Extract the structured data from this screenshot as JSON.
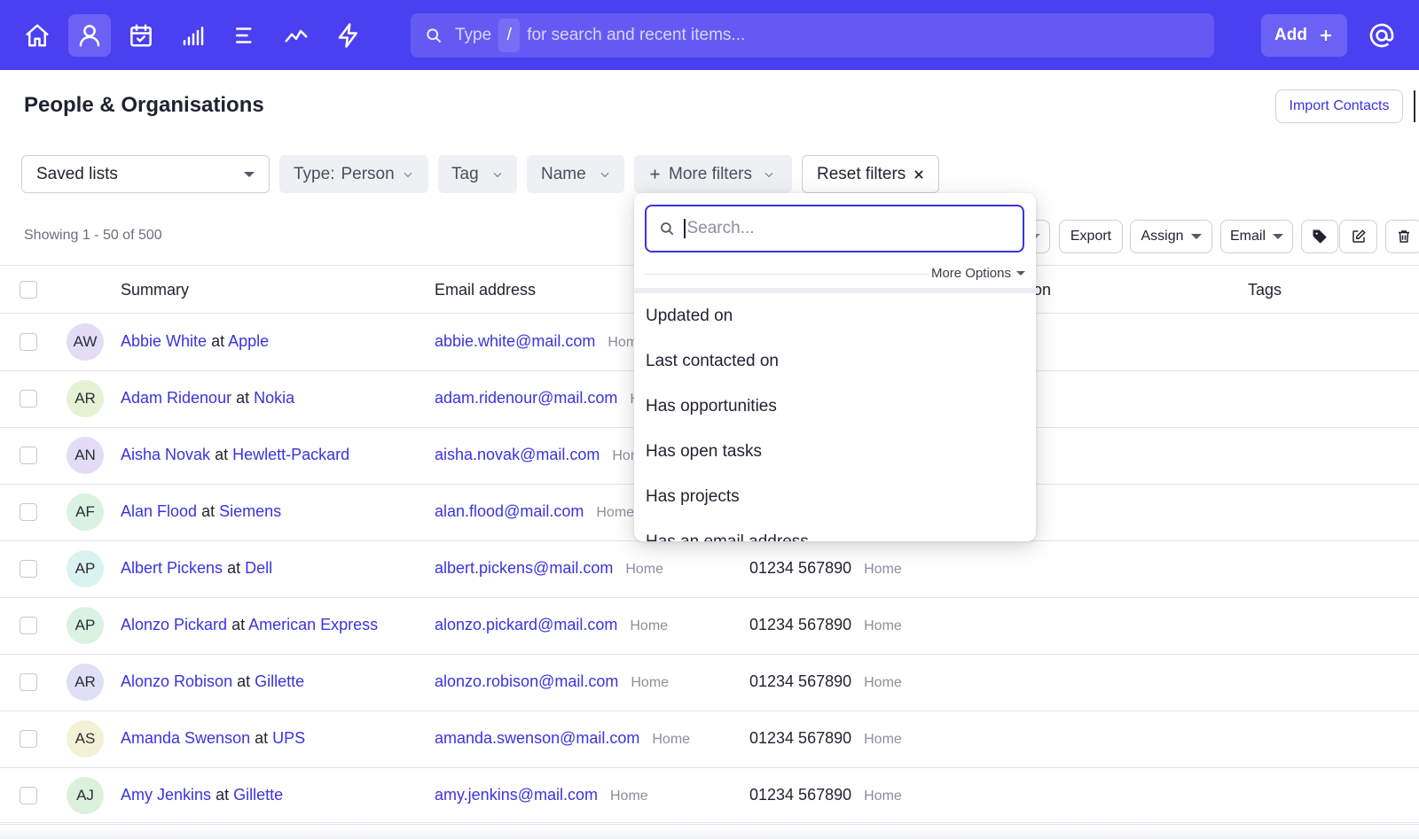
{
  "topbar": {
    "search_prefix": "Type",
    "search_key": "/",
    "search_suffix": "for search and recent items...",
    "add_label": "Add",
    "nav_icons": [
      "home-icon",
      "person-icon",
      "calendar-check-icon",
      "bar-signal-icon",
      "list-icon",
      "trend-line-icon",
      "lightning-icon"
    ],
    "accent": "#4b3ff2"
  },
  "page": {
    "title": "People & Organisations",
    "import_label": "Import Contacts",
    "showing": "Showing 1 - 50 of 500"
  },
  "filters": {
    "saved_lists": "Saved lists",
    "type_label": "Type:",
    "type_value": "Person",
    "tag": "Tag",
    "name": "Name",
    "more_filters": "More filters",
    "reset": "Reset filters"
  },
  "actions": {
    "export": "Export",
    "assign": "Assign",
    "email": "Email"
  },
  "table": {
    "headers": {
      "summary": "Summary",
      "email": "Email address",
      "hidden_col_tail": "on",
      "tags": "Tags"
    },
    "at": "at",
    "rows": [
      {
        "initials": "AW",
        "name": "Abbie White",
        "org": "Apple",
        "email": "abbie.white@mail.com",
        "email_label": "Home",
        "phone": "",
        "phone_label": "",
        "avatar": "#e3dcf6"
      },
      {
        "initials": "AR",
        "name": "Adam Ridenour",
        "org": "Nokia",
        "email": "adam.ridenour@mail.com",
        "email_label": "H",
        "phone": "",
        "phone_label": "",
        "avatar": "#e6f2d6"
      },
      {
        "initials": "AN",
        "name": "Aisha Novak",
        "org": "Hewlett-Packard",
        "email": "aisha.novak@mail.com",
        "email_label": "Hom",
        "phone": "",
        "phone_label": "",
        "avatar": "#e3dcf6"
      },
      {
        "initials": "AF",
        "name": "Alan Flood",
        "org": "Siemens",
        "email": "alan.flood@mail.com",
        "email_label": "Home",
        "phone": "",
        "phone_label": "",
        "avatar": "#daf2e2"
      },
      {
        "initials": "AP",
        "name": "Albert Pickens",
        "org": "Dell",
        "email": "albert.pickens@mail.com",
        "email_label": "Home",
        "phone": "01234 567890",
        "phone_label": "Home",
        "avatar": "#d9f3f1"
      },
      {
        "initials": "AP",
        "name": "Alonzo Pickard",
        "org": "American Express",
        "email": "alonzo.pickard@mail.com",
        "email_label": "Home",
        "phone": "01234 567890",
        "phone_label": "Home",
        "avatar": "#daf2e2"
      },
      {
        "initials": "AR",
        "name": "Alonzo Robison",
        "org": "Gillette",
        "email": "alonzo.robison@mail.com",
        "email_label": "Home",
        "phone": "01234 567890",
        "phone_label": "Home",
        "avatar": "#dfdff6"
      },
      {
        "initials": "AS",
        "name": "Amanda Swenson",
        "org": "UPS",
        "email": "amanda.swenson@mail.com",
        "email_label": "Home",
        "phone": "01234 567890",
        "phone_label": "Home",
        "avatar": "#f4f2d6"
      },
      {
        "initials": "AJ",
        "name": "Amy Jenkins",
        "org": "Gillette",
        "email": "amy.jenkins@mail.com",
        "email_label": "Home",
        "phone": "01234 567890",
        "phone_label": "Home",
        "avatar": "#dbf1dc"
      }
    ]
  },
  "dropdown": {
    "search_placeholder": "Search...",
    "more_options": "More Options",
    "items": [
      "Updated on",
      "Last contacted on",
      "Has opportunities",
      "Has open tasks",
      "Has projects",
      "Has an email address"
    ]
  }
}
